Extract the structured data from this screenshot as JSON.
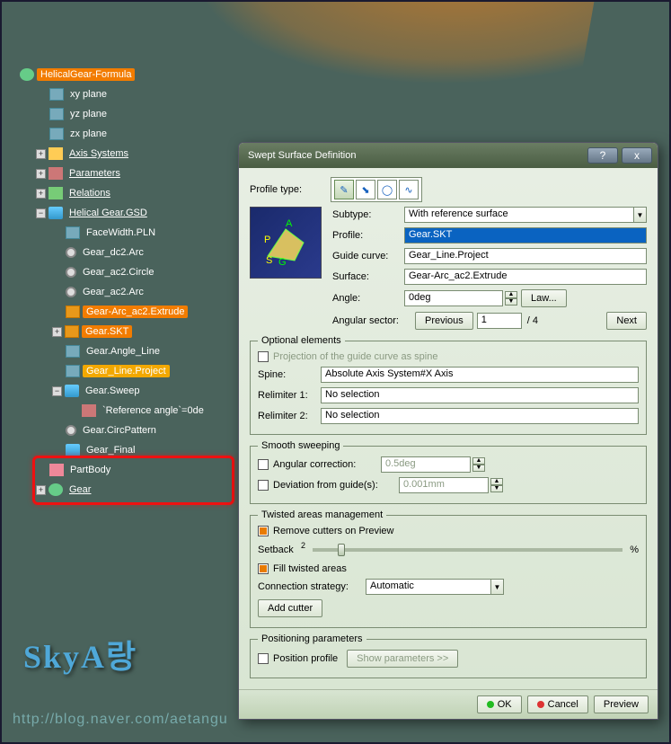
{
  "tree": {
    "root": "HelicalGear-Formula",
    "items": [
      {
        "indent": 1,
        "icon": "plane",
        "label": "xy plane",
        "exp": ""
      },
      {
        "indent": 1,
        "icon": "plane",
        "label": "yz plane",
        "exp": ""
      },
      {
        "indent": 1,
        "icon": "plane",
        "label": "zx plane",
        "exp": ""
      },
      {
        "indent": 1,
        "icon": "axis",
        "label": "Axis Systems",
        "exp": "+",
        "under": true
      },
      {
        "indent": 1,
        "icon": "param",
        "label": "Parameters",
        "exp": "+",
        "under": true
      },
      {
        "indent": 1,
        "icon": "rel",
        "label": "Relations",
        "exp": "+",
        "under": true
      },
      {
        "indent": 1,
        "icon": "gsd",
        "label": "Helical Gear.GSD",
        "exp": "−",
        "under": true
      },
      {
        "indent": 2,
        "icon": "plane",
        "label": "FaceWidth.PLN",
        "exp": ""
      },
      {
        "indent": 2,
        "icon": "circle",
        "label": "Gear_dc2.Arc",
        "exp": ""
      },
      {
        "indent": 2,
        "icon": "circle",
        "label": "Gear_ac2.Circle",
        "exp": ""
      },
      {
        "indent": 2,
        "icon": "circle",
        "label": "Gear_ac2.Arc",
        "exp": ""
      },
      {
        "indent": 2,
        "icon": "square",
        "label": "Gear-Arc_ac2.Extrude",
        "sel": true,
        "exp": ""
      },
      {
        "indent": 2,
        "icon": "square",
        "label": "Gear.SKT",
        "sel": true,
        "exp": "+"
      },
      {
        "indent": 2,
        "icon": "plane",
        "label": "Gear.Angle_Line",
        "exp": ""
      },
      {
        "indent": 2,
        "icon": "plane",
        "label": "Gear_Line.Project",
        "sel2": true,
        "exp": ""
      },
      {
        "indent": 2,
        "icon": "gsd",
        "label": "Gear.Sweep",
        "exp": "−"
      },
      {
        "indent": 3,
        "icon": "param",
        "label": "`Reference angle`=0de",
        "exp": ""
      },
      {
        "indent": 2,
        "icon": "circle",
        "label": "Gear.CircPattern",
        "exp": ""
      },
      {
        "indent": 2,
        "icon": "gsd",
        "label": "Gear_Final",
        "exp": ""
      },
      {
        "indent": 1,
        "icon": "body",
        "label": "PartBody",
        "exp": ""
      },
      {
        "indent": 1,
        "icon": "gear",
        "label": "Gear",
        "exp": "+",
        "under": true
      }
    ]
  },
  "dialog": {
    "title": "Swept Surface Definition",
    "profile_type_label": "Profile type:",
    "subtype_label": "Subtype:",
    "subtype_value": "With reference surface",
    "profile_label": "Profile:",
    "profile_value": "Gear.SKT",
    "guide_label": "Guide curve:",
    "guide_value": "Gear_Line.Project",
    "surface_label": "Surface:",
    "surface_value": "Gear-Arc_ac2.Extrude",
    "angle_label": "Angle:",
    "angle_value": "0deg",
    "law_btn": "Law...",
    "angsector_label": "Angular sector:",
    "prev_btn": "Previous",
    "sector_val": "1",
    "sector_total": "/ 4",
    "next_btn": "Next",
    "opt_legend": "Optional elements",
    "proj_label": "Projection of the guide curve as spine",
    "spine_label": "Spine:",
    "spine_value": "Absolute Axis System#X Axis",
    "relim1_label": "Relimiter 1:",
    "relim1_value": "No selection",
    "relim2_label": "Relimiter 2:",
    "relim2_value": "No selection",
    "smooth_legend": "Smooth sweeping",
    "angcorr_label": "Angular correction:",
    "angcorr_value": "0.5deg",
    "dev_label": "Deviation from guide(s):",
    "dev_value": "0.001mm",
    "twist_legend": "Twisted areas management",
    "remove_label": "Remove cutters on Preview",
    "setback_label": "Setback",
    "setback_tick": "2",
    "setback_pct": "%",
    "fill_label": "Fill twisted areas",
    "conn_label": "Connection strategy:",
    "conn_value": "Automatic",
    "addcutter_btn": "Add cutter",
    "pos_legend": "Positioning parameters",
    "posprofile_label": "Position profile",
    "showparams_btn": "Show parameters >>",
    "ok_btn": "OK",
    "cancel_btn": "Cancel",
    "preview_btn": "Preview"
  },
  "watermark": {
    "main": "SkyA랑",
    "url": "http://blog.naver.com/aetangu"
  }
}
